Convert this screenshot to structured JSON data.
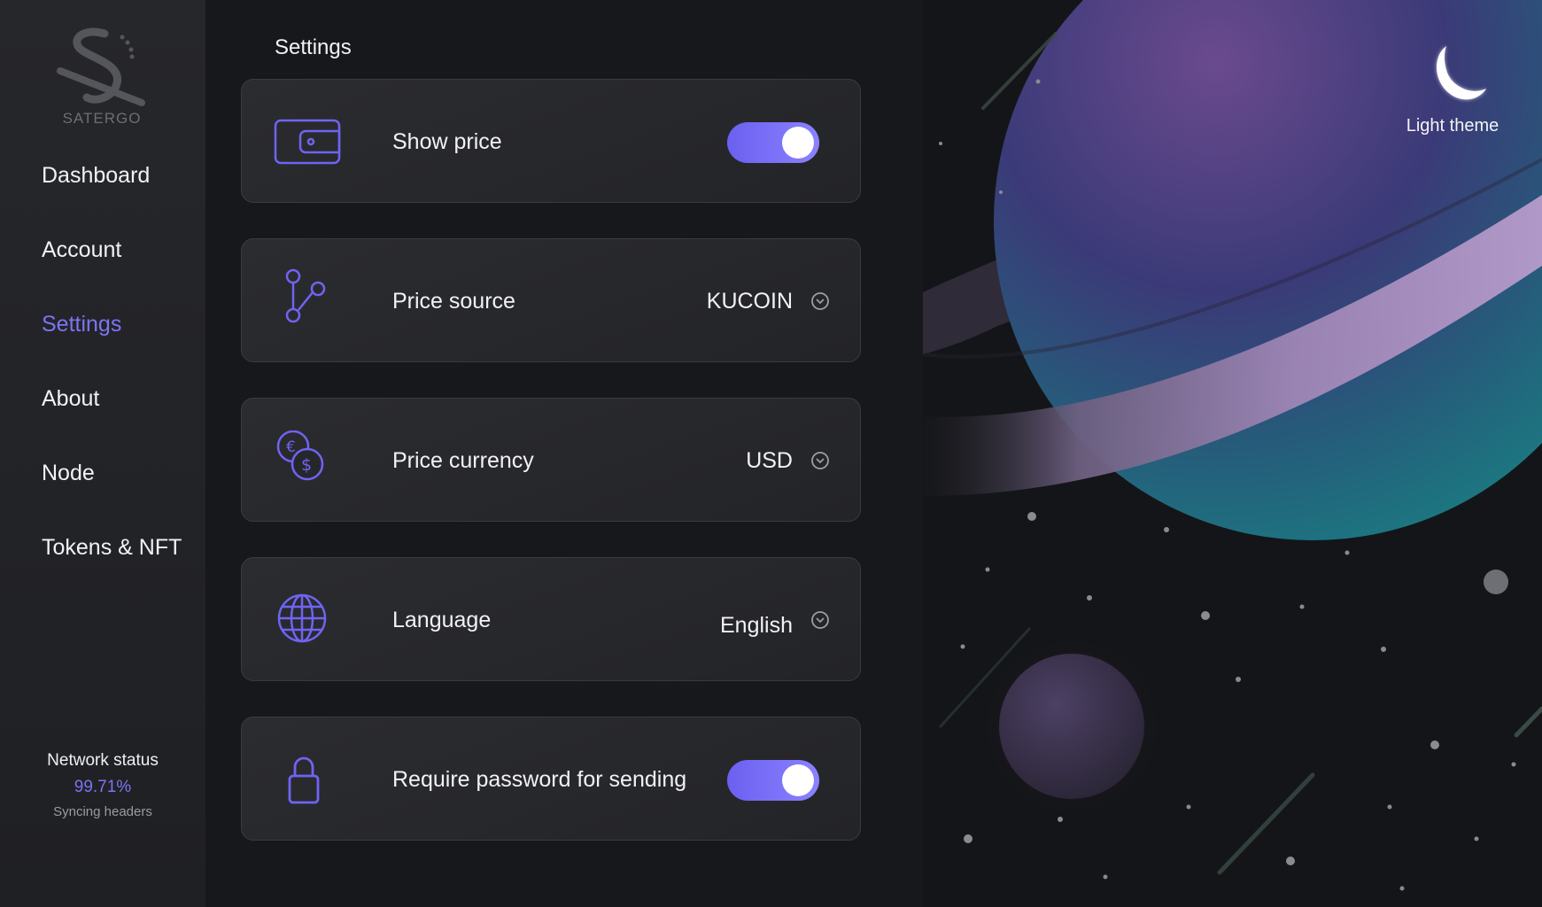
{
  "app": {
    "logo_text": "SATERGO"
  },
  "sidebar": {
    "items": [
      {
        "label": "Dashboard",
        "active": false
      },
      {
        "label": "Account",
        "active": false
      },
      {
        "label": "Settings",
        "active": true
      },
      {
        "label": "About",
        "active": false
      },
      {
        "label": "Node",
        "active": false
      },
      {
        "label": "Tokens & NFT",
        "active": false
      }
    ],
    "network_status": {
      "title": "Network status",
      "percent": "99.71%",
      "detail": "Syncing headers"
    }
  },
  "page": {
    "title": "Settings"
  },
  "settings": {
    "show_price": {
      "label": "Show price",
      "enabled": true,
      "icon": "wallet-icon"
    },
    "price_source": {
      "label": "Price source",
      "value": "KUCOIN",
      "icon": "branch-icon"
    },
    "price_currency": {
      "label": "Price currency",
      "value": "USD",
      "icon": "currency-exchange-icon"
    },
    "language": {
      "label": "Language",
      "value": "English",
      "icon": "globe-icon"
    },
    "require_password": {
      "label": "Require password for sending",
      "enabled": true,
      "icon": "lock-icon"
    }
  },
  "theme": {
    "label": "Light theme",
    "icon": "moon-icon"
  },
  "colors": {
    "accent": "#7b74f3",
    "toggle_start": "#6b60f0",
    "toggle_end": "#8a82ff",
    "background": "#17181b"
  }
}
